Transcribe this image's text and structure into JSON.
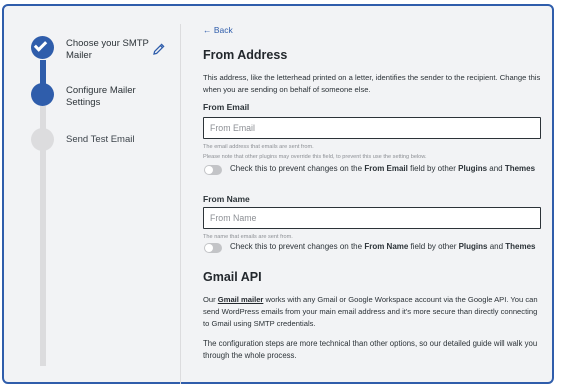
{
  "steps": [
    {
      "label": "Choose your SMTP Mailer",
      "state": "done"
    },
    {
      "label": "Configure Mailer Settings",
      "state": "active"
    },
    {
      "label": "Send Test Email",
      "state": "todo"
    }
  ],
  "back_label": "← Back",
  "from_address": {
    "title": "From Address",
    "description": "This address, like the letterhead printed on a letter, identifies the sender to the recipient. Change this when you are sending on behalf of someone else."
  },
  "from_email": {
    "label": "From Email",
    "placeholder": "From Email",
    "help1": "The email address that emails are sent from.",
    "help2": "Please note that other plugins may override this field, to prevent this use the setting below.",
    "toggle_prefix": "Check this to prevent changes on the ",
    "toggle_field": "From Email",
    "toggle_mid": " field by other ",
    "toggle_plugins": "Plugins",
    "toggle_and": " and ",
    "toggle_themes": "Themes"
  },
  "from_name": {
    "label": "From Name",
    "placeholder": "From Name",
    "help1": "The name that emails are sent from.",
    "toggle_prefix": "Check this to prevent changes on the ",
    "toggle_field": "From Name",
    "toggle_mid": " field by other ",
    "toggle_plugins": "Plugins",
    "toggle_and": " and ",
    "toggle_themes": "Themes"
  },
  "gmail": {
    "title": "Gmail API",
    "p1_prefix": "Our ",
    "p1_link": "Gmail mailer",
    "p1_rest": " works with any Gmail or Google Workspace account via the Google API. You can send WordPress emails from your main email address and it's more secure than directly connecting to Gmail using SMTP credentials.",
    "p2": "The configuration steps are more technical than other options, so our detailed guide will walk you through the whole process."
  },
  "colors": {
    "accent": "#2f5dab",
    "inactive": "#dcdcde"
  }
}
